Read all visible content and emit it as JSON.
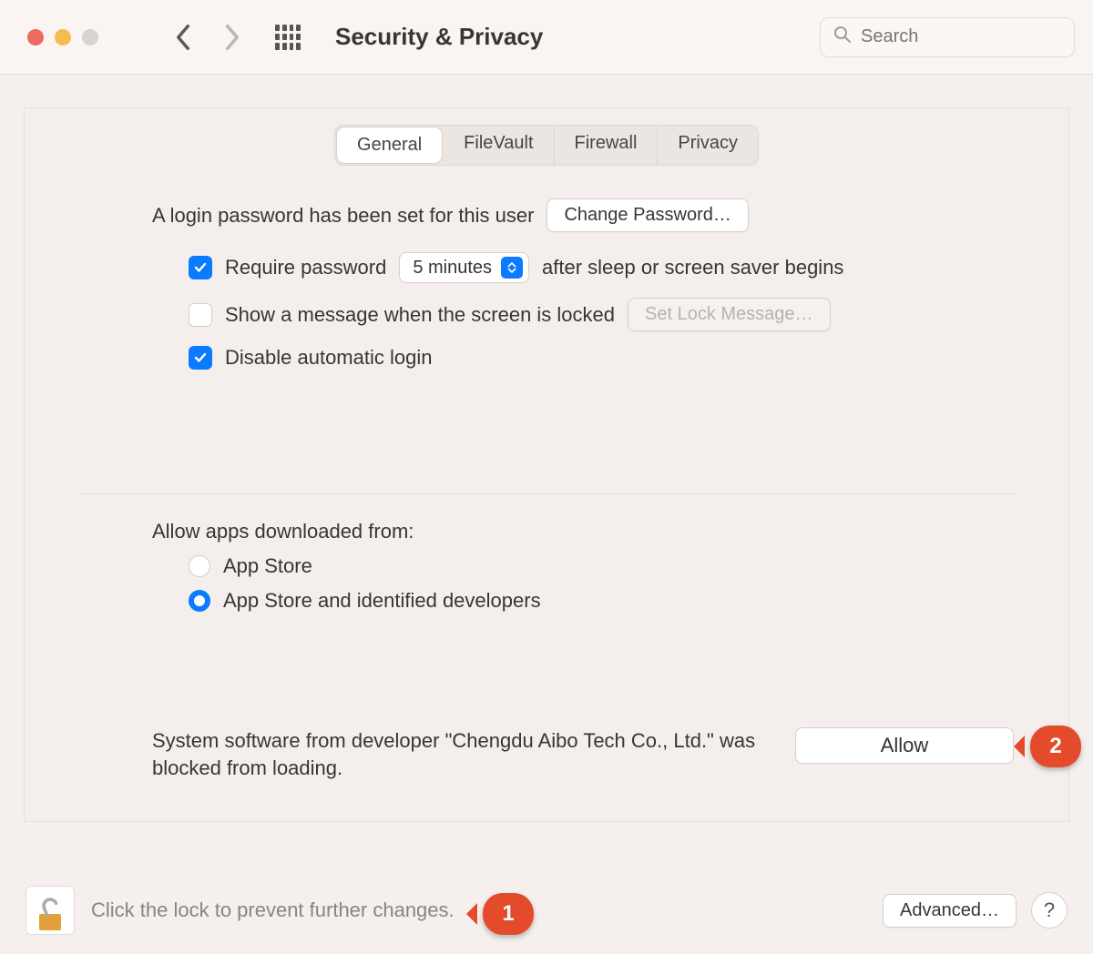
{
  "toolbar": {
    "title": "Security & Privacy",
    "search_placeholder": "Search"
  },
  "tabs": {
    "general": "General",
    "filevault": "FileVault",
    "firewall": "Firewall",
    "privacy": "Privacy"
  },
  "general": {
    "login_text": "A login password has been set for this user",
    "change_password": "Change Password…",
    "require_password_label": "Require password",
    "require_password_delay": "5 minutes",
    "require_password_suffix": "after sleep or screen saver begins",
    "show_message_label": "Show a message when the screen is locked",
    "set_lock_message": "Set Lock Message…",
    "disable_auto_login": "Disable automatic login",
    "allow_apps_heading": "Allow apps downloaded from:",
    "radio_appstore": "App Store",
    "radio_appstore_dev": "App Store and identified developers",
    "blocked_text": "System software from developer \"Chengdu Aibo Tech Co., Ltd.\" was blocked from loading.",
    "allow_button": "Allow"
  },
  "footer": {
    "lock_text": "Click the lock to prevent further changes.",
    "advanced": "Advanced…",
    "help": "?"
  },
  "callouts": {
    "one": "1",
    "two": "2"
  }
}
